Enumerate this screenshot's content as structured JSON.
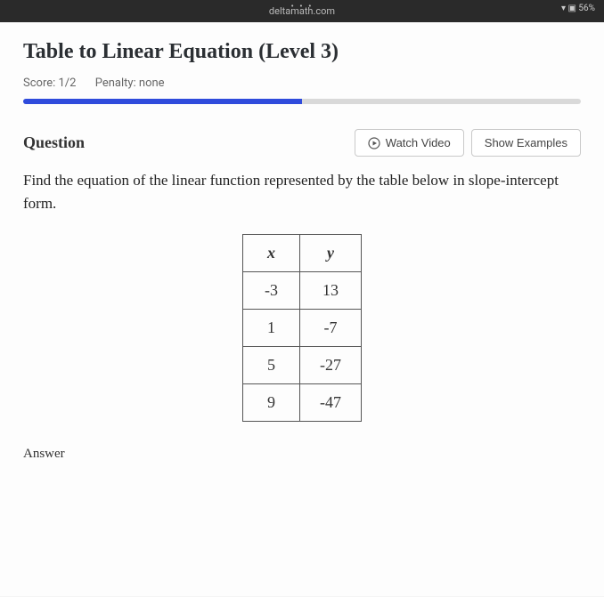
{
  "browser": {
    "url_hint": "deltamath.com",
    "battery": "56%"
  },
  "page": {
    "title": "Table to Linear Equation (Level 3)",
    "score_label": "Score: 1/2",
    "penalty_label": "Penalty: none",
    "progress_percent": 50
  },
  "question": {
    "label": "Question",
    "watch_video": "Watch Video",
    "show_examples": "Show Examples",
    "prompt": "Find the equation of the linear function represented by the table below in slope-intercept form.",
    "table": {
      "headers": {
        "x": "x",
        "y": "y"
      },
      "rows": [
        {
          "x": "-3",
          "y": "13"
        },
        {
          "x": "1",
          "y": "-7"
        },
        {
          "x": "5",
          "y": "-27"
        },
        {
          "x": "9",
          "y": "-47"
        }
      ]
    },
    "answer_label": "Answer"
  }
}
